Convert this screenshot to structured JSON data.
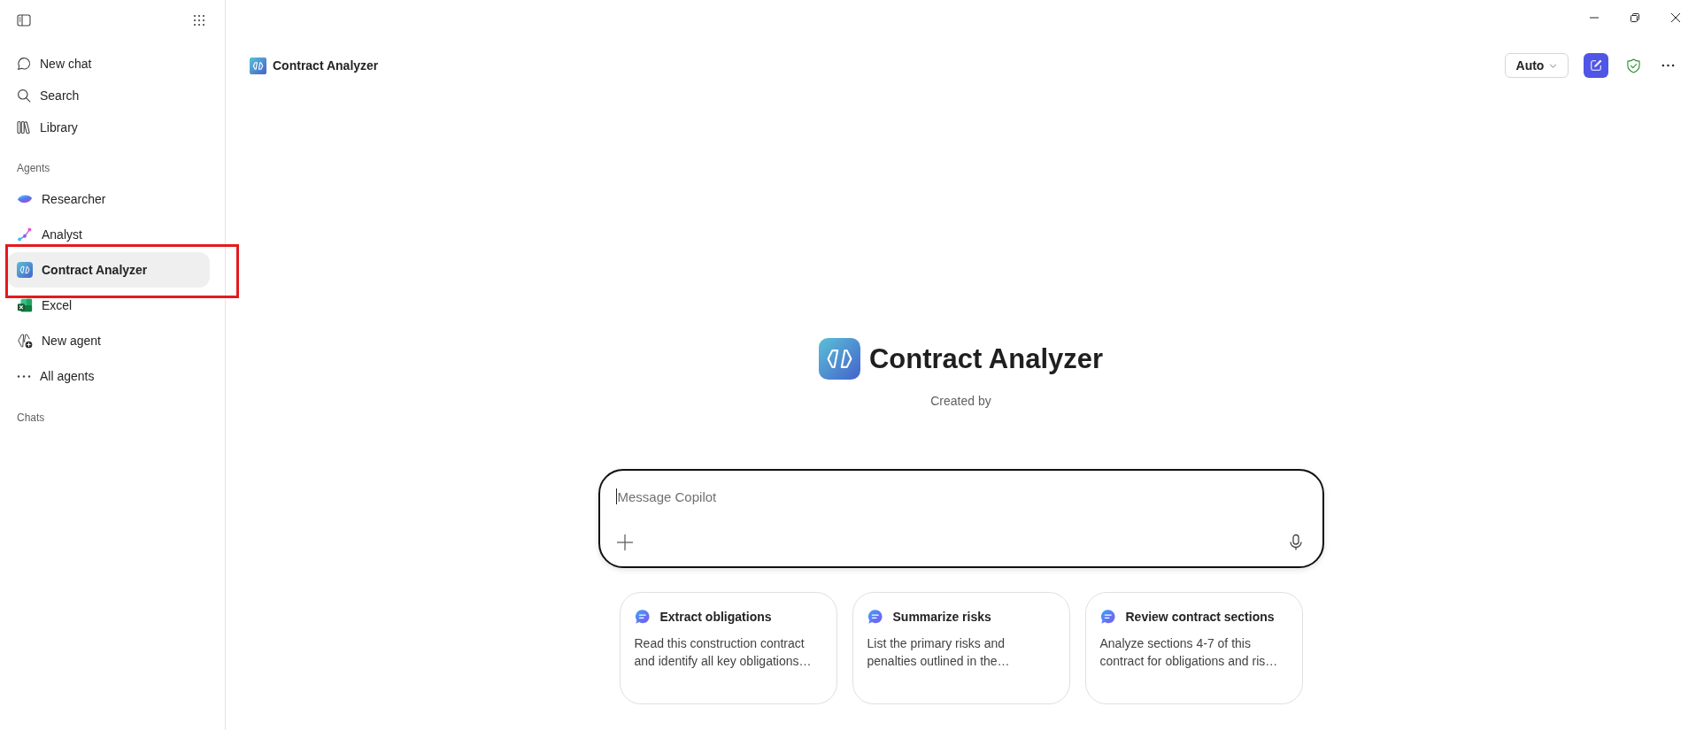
{
  "sidebar": {
    "nav": [
      {
        "label": "New chat"
      },
      {
        "label": "Search"
      },
      {
        "label": "Library"
      }
    ],
    "agents": {
      "heading": "Agents",
      "items": [
        {
          "label": "Researcher",
          "selected": false,
          "highlighted": false
        },
        {
          "label": "Analyst",
          "selected": false,
          "highlighted": false
        },
        {
          "label": "Contract Analyzer",
          "selected": true,
          "highlighted": true
        },
        {
          "label": "Excel",
          "selected": false,
          "highlighted": false
        },
        {
          "label": "New agent",
          "selected": false,
          "highlighted": false
        },
        {
          "label": "All agents",
          "selected": false,
          "highlighted": false
        }
      ]
    },
    "chats": {
      "heading": "Chats"
    }
  },
  "header": {
    "title": "Contract Analyzer",
    "model_picker": "Auto"
  },
  "hero": {
    "title": "Contract Analyzer",
    "subtitle": "Created by"
  },
  "composer": {
    "placeholder": "Message Copilot"
  },
  "suggestions": [
    {
      "title": "Extract obligations",
      "text": "Read this construction contract and identify all key obligations…"
    },
    {
      "title": "Summarize risks",
      "text": "List the primary risks and penalties outlined in the…"
    },
    {
      "title": "Review contract sections",
      "text": "Analyze sections 4-7 of this contract for obligations and ris…"
    }
  ]
}
